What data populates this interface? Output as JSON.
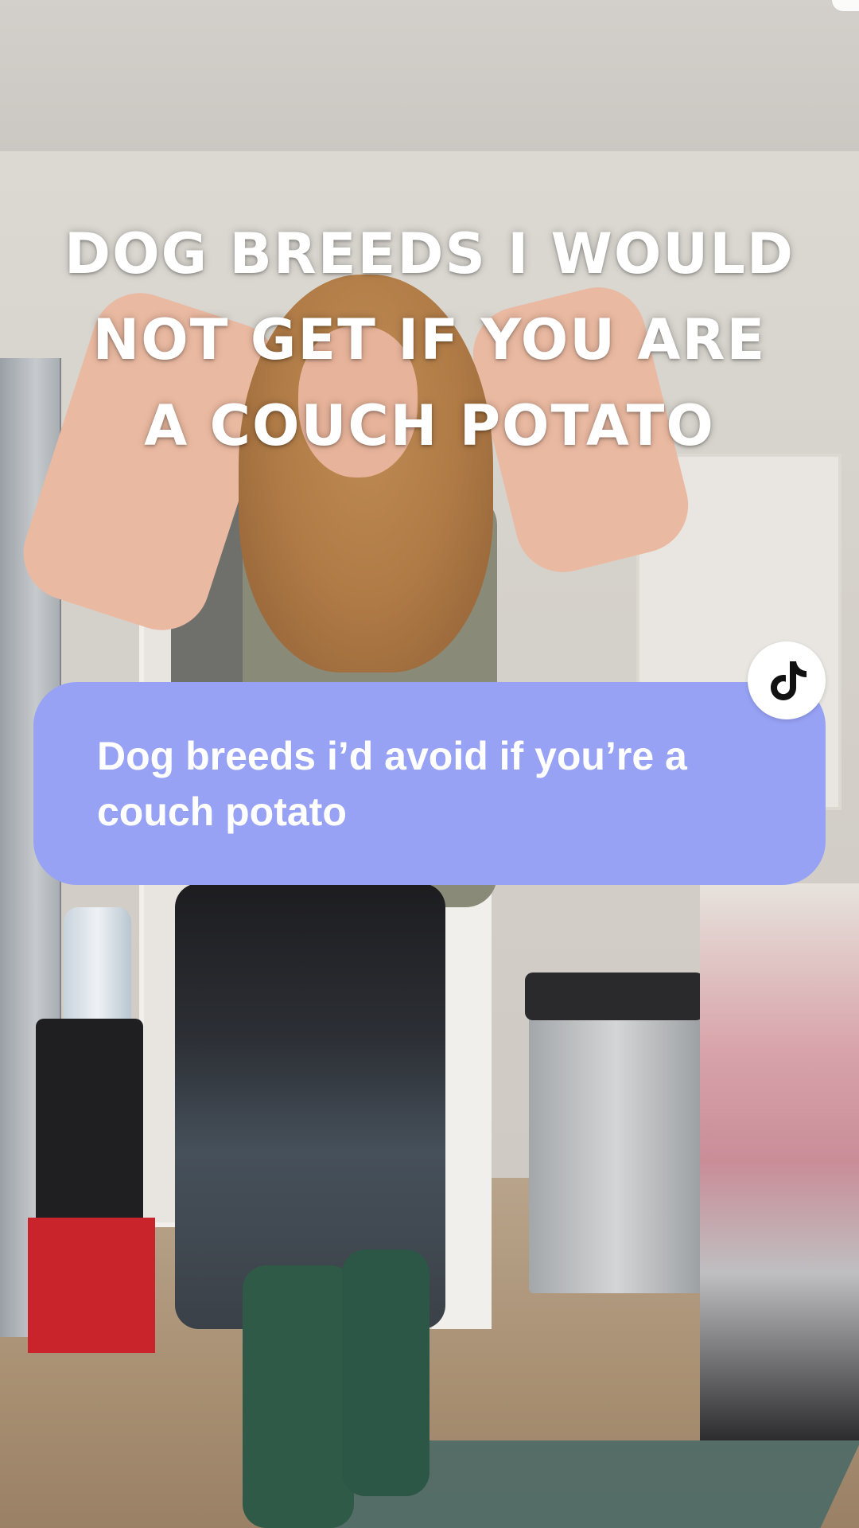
{
  "headline": {
    "line1": "DOG BREEDS I WOULD",
    "line2": "NOT GET IF YOU ARE",
    "line3": "A COUCH POTATO"
  },
  "caption": {
    "text": "Dog breeds i’d avoid if you’re a couch potato"
  },
  "colors": {
    "caption_background": "#97a2f5",
    "text": "#ffffff"
  },
  "icons": {
    "badge": "tiktok-logo-icon"
  }
}
